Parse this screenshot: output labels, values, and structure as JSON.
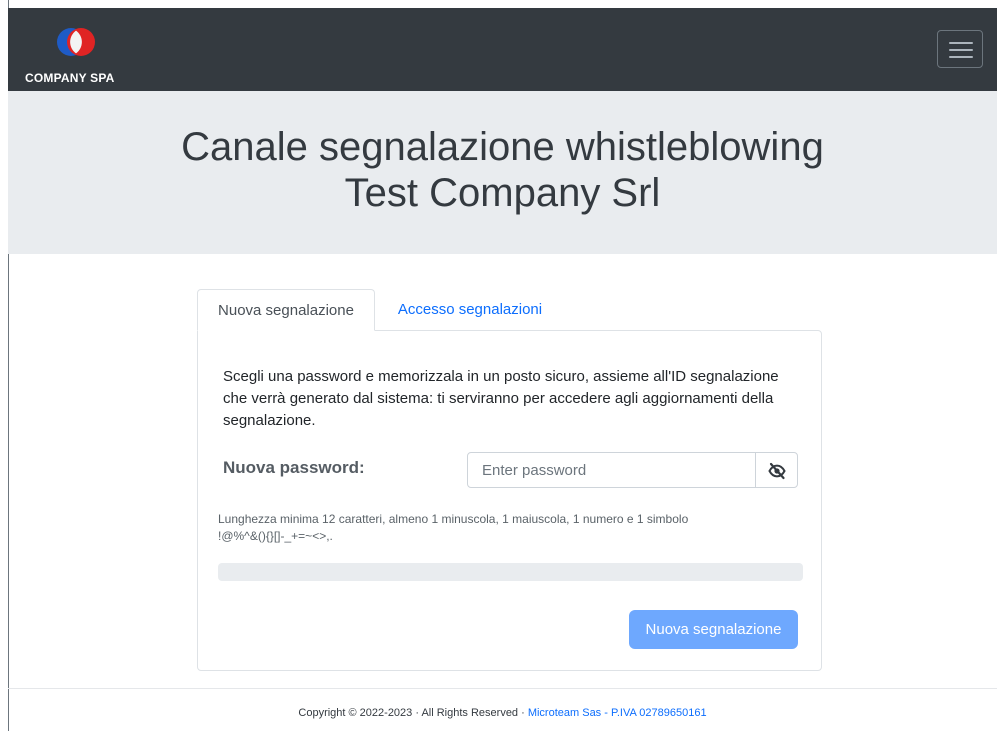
{
  "navbar": {
    "brand_text": "COMPANY SPA",
    "menu_toggle": "menu"
  },
  "hero": {
    "title_line1": "Canale segnalazione whistleblowing",
    "title_line2": "Test Company Srl"
  },
  "tabs": [
    {
      "label": "Nuova segnalazione",
      "active": true
    },
    {
      "label": "Accesso segnalazioni",
      "active": false
    }
  ],
  "form": {
    "intro": "Scegli una password e memorizzala in un posto sicuro, assieme all'ID segnalazione che verrà generato dal sistema: ti serviranno per accedere agli aggiornamenti della segnalazione.",
    "password_label": "Nuova password:",
    "password_placeholder": "Enter password",
    "password_value": "",
    "toggle_visibility_icon": "eye-slash-icon",
    "hint_line1": "Lunghezza minima 12 caratteri, almeno 1 minuscola, 1 maiuscola, 1 numero e 1 simbolo",
    "hint_line2": "!@%^&(){}[]-_+=~<>,.",
    "strength_percent": 0,
    "submit_label": "Nuova segnalazione"
  },
  "footer": {
    "copyright": "Copyright © 2022-2023 · All Rights Reserved · ",
    "link_text": "Microteam Sas - P.IVA 02789650161"
  },
  "colors": {
    "navbar_bg": "#343a40",
    "hero_bg": "#e9ecef",
    "link": "#0d6efd",
    "submit_bg": "#6ea8fe",
    "logo_blue": "#1e5bc6",
    "logo_red": "#e02424"
  }
}
